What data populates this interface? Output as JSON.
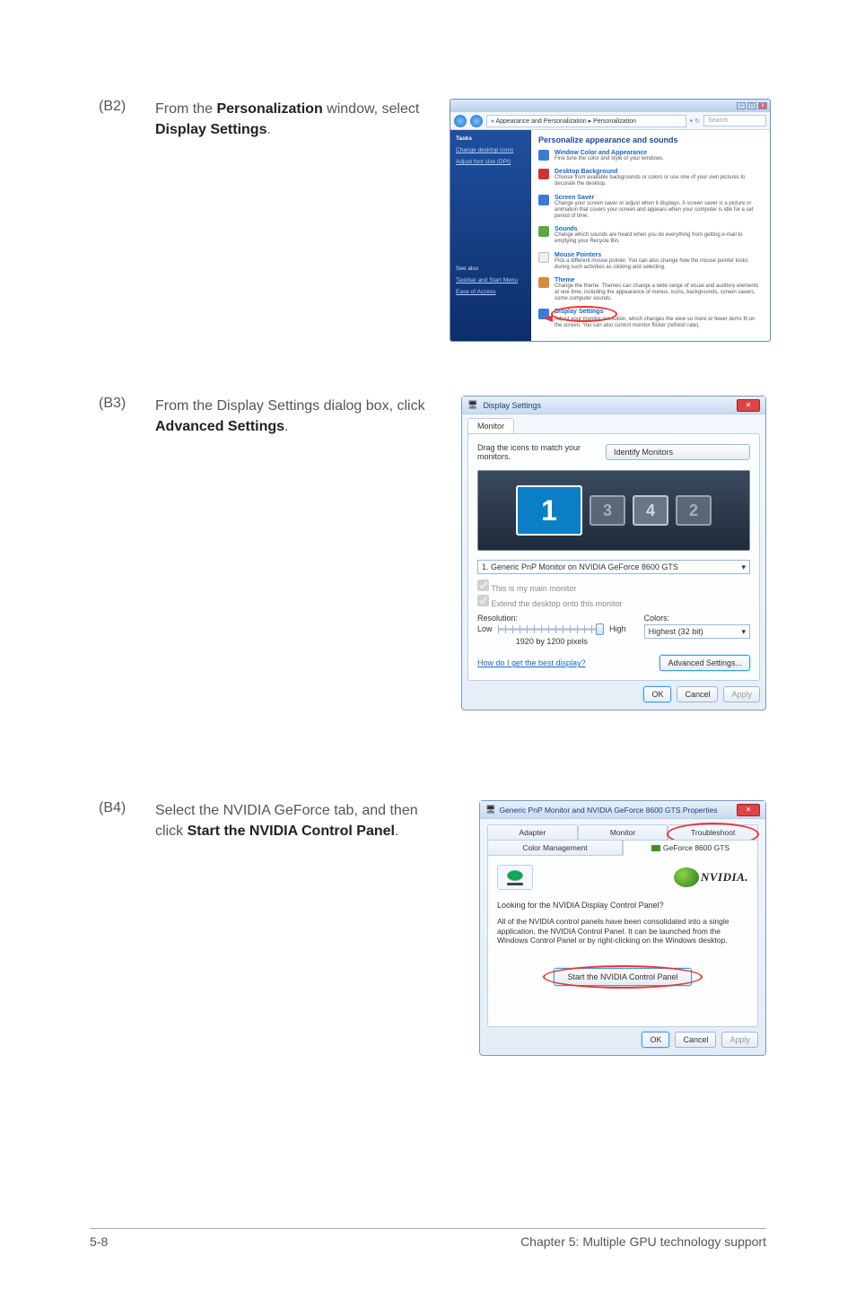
{
  "steps": {
    "b2": {
      "label": "(B2)",
      "text_pre": "From the ",
      "bold1": "Personalization",
      "text_mid": " window, select ",
      "bold2": "Display Settings",
      "text_post": "."
    },
    "b3": {
      "label": "(B3)",
      "text_pre": "From the Display Settings dialog box, click ",
      "bold1": "Advanced Settings",
      "text_post": "."
    },
    "b4": {
      "label": "(B4)",
      "text_pre": "Select the NVIDIA GeForce tab, and then click ",
      "bold1": "Start the NVIDIA Control Panel",
      "text_post": "."
    }
  },
  "shot1": {
    "breadcrumb": "« Appearance and Personalization ▸ Personalization",
    "search": "Search",
    "side": {
      "tasks": "Tasks",
      "change_icons": "Change desktop icons",
      "adjust_font": "Adjust font size (DPI)",
      "see_also": "See also",
      "taskbar": "Taskbar and Start Menu",
      "ease": "Ease of Access"
    },
    "main_heading": "Personalize appearance and sounds",
    "items": [
      {
        "title": "Window Color and Appearance",
        "desc": "Fine tune the color and style of your windows."
      },
      {
        "title": "Desktop Background",
        "desc": "Choose from available backgrounds or colors or use one of your own pictures to decorate the desktop."
      },
      {
        "title": "Screen Saver",
        "desc": "Change your screen saver or adjust when it displays. A screen saver is a picture or animation that covers your screen and appears when your computer is idle for a set period of time."
      },
      {
        "title": "Sounds",
        "desc": "Change which sounds are heard when you do everything from getting e-mail to emptying your Recycle Bin."
      },
      {
        "title": "Mouse Pointers",
        "desc": "Pick a different mouse pointer. You can also change how the mouse pointer looks during such activities as clicking and selecting."
      },
      {
        "title": "Theme",
        "desc": "Change the theme. Themes can change a wide range of visual and auditory elements at one time, including the appearance of menus, icons, backgrounds, screen savers, some computer sounds."
      },
      {
        "title": "Display Settings",
        "desc": "Adjust your monitor resolution, which changes the view so more or fewer items fit on the screen. You can also control monitor flicker (refresh rate)."
      }
    ]
  },
  "shot2": {
    "title": "Display Settings",
    "tab": "Monitor",
    "drag": "Drag the icons to match your monitors.",
    "identify": "Identify Monitors",
    "mon1": "1",
    "mon_small1": "3",
    "mon_small2": "4",
    "mon_small3": "2",
    "combo": "1. Generic PnP Monitor on NVIDIA GeForce 8600 GTS",
    "chk1": "This is my main monitor",
    "chk2": "Extend the desktop onto this monitor",
    "res_label": "Resolution:",
    "low": "Low",
    "high": "High",
    "res_value": "1920 by 1200 pixels",
    "colors_label": "Colors:",
    "colors_value": "Highest (32 bit)",
    "best": "How do I get the best display?",
    "adv": "Advanced Settings...",
    "ok": "OK",
    "cancel": "Cancel",
    "apply": "Apply"
  },
  "shot3": {
    "title": "Generic PnP Monitor and NVIDIA GeForce 8600 GTS Properties",
    "tabs_top": [
      "Adapter",
      "Monitor",
      "Troubleshoot"
    ],
    "tabs_bot": [
      "Color Management",
      "GeForce 8600 GTS"
    ],
    "nvname": "NVIDIA.",
    "looking": "Looking for the NVIDIA Display Control Panel?",
    "desc": "All of the NVIDIA control panels have been consolidated into a single application, the NVIDIA Control Panel. It can be launched from the Windows Control Panel or by right-clicking on the Windows desktop.",
    "start": "Start the NVIDIA Control Panel",
    "ok": "OK",
    "cancel": "Cancel",
    "apply": "Apply"
  },
  "footer": {
    "left": "5-8",
    "right": "Chapter 5: Multiple GPU technology support"
  }
}
